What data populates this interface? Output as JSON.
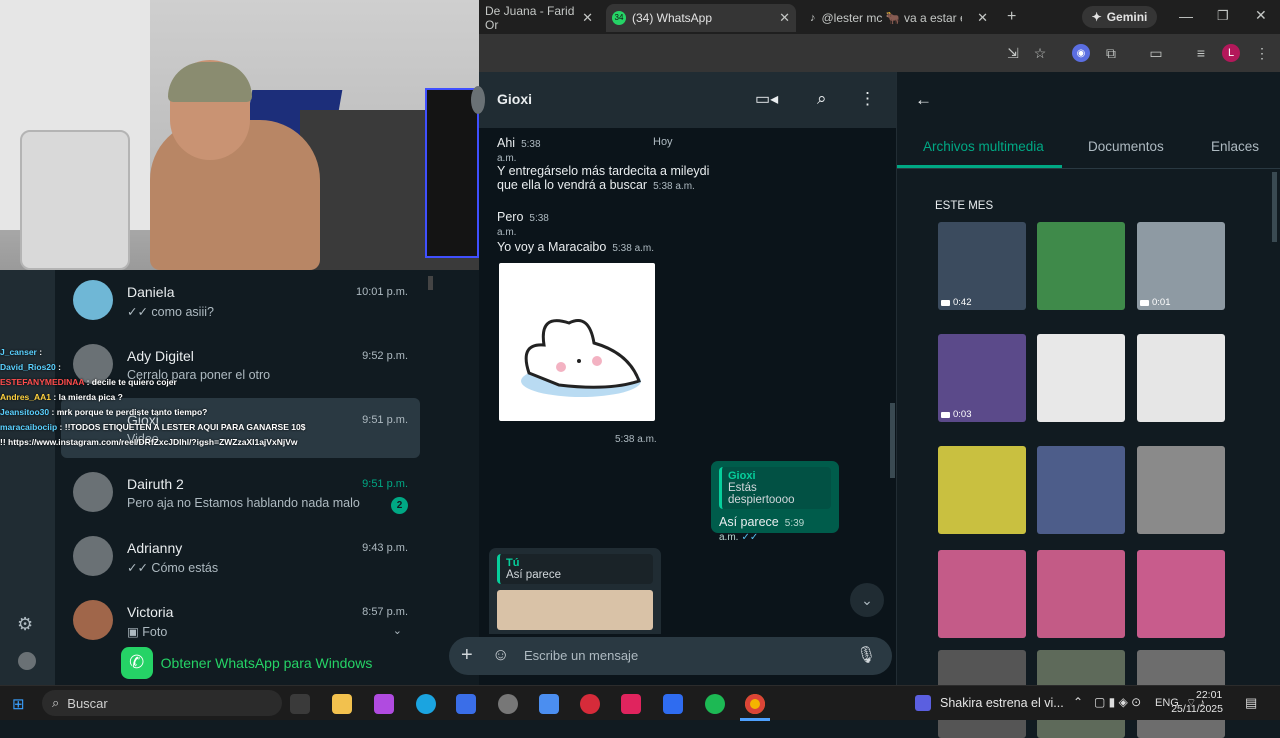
{
  "browser": {
    "tabs": [
      {
        "label": "De Juana - Farid Or"
      },
      {
        "label": "(34) WhatsApp",
        "favicon_text": "34"
      },
      {
        "label": "@lester mc 🐂 va a estar en la"
      }
    ],
    "gemini_label": "Gemini",
    "profile_letter": "L"
  },
  "stream_chat": [
    {
      "user": "J_canser",
      "text": "",
      "color": "#5ad1ff"
    },
    {
      "user": "David_Rios20",
      "text": "",
      "color": "#5ad1ff"
    },
    {
      "user": "ESTEFANYMEDINAA",
      "text": "decile te quiero cojer",
      "color": "#ff4d4d"
    },
    {
      "user": "Andres_AA1",
      "text": "la mierda pica ?",
      "color": "#ffd23f"
    },
    {
      "user": "Jeansitoo30",
      "text": "mrk porque te perdiste tanto tiempo?",
      "color": "#5ad1ff"
    },
    {
      "user": "maracaibociip",
      "text": "!!TODOS ETIQUETEN A LESTER AQUI PARA GANARSE 10$",
      "color": "#5ad1ff"
    },
    {
      "user": "",
      "text": "!! https://www.instagram.com/reel/DRfZxcJDlhl/?igsh=ZWZzaXI1ajVxNjVw",
      "color": "#ffffff"
    }
  ],
  "chat_list": [
    {
      "name": "Daniela",
      "preview": "✓✓ como asiii?",
      "time": "10:01 p.m."
    },
    {
      "name": "Ady Digitel",
      "preview": "Cerralo para poner el otro",
      "time": "9:52 p.m."
    },
    {
      "name": "Gioxi",
      "preview": "Video",
      "time": "9:51 p.m."
    },
    {
      "name": "Dairuth 2",
      "preview": "Pero aja no Estamos hablando nada malo",
      "time": "9:51 p.m.",
      "unread": "2"
    },
    {
      "name": "Adrianny",
      "preview": "✓✓ Cómo estás",
      "time": "9:43 p.m."
    },
    {
      "name": "Victoria",
      "preview": "Foto",
      "time": "8:57 p.m."
    }
  ],
  "get_whatsapp": "Obtener WhatsApp para Windows",
  "conversation": {
    "contact": "Gioxi",
    "day_label": "Hoy",
    "messages": [
      {
        "text": "Ahi",
        "time": "5:38 a.m."
      },
      {
        "text": "Y entregárselo más tardecita a mileydi que ella lo vendrá a buscar",
        "time": "5:38 a.m."
      },
      {
        "text": "Pero",
        "time": "5:38 a.m."
      },
      {
        "text": "Yo voy a Maracaibo",
        "time": "5:38 a.m."
      },
      {
        "sticker_time": "5:38 a.m."
      }
    ],
    "reply_out": {
      "quoted_name": "Gioxi",
      "quoted_text": "Estás despiertoooo",
      "text": "Así parece",
      "time": "5:39 a.m."
    },
    "reply_in": {
      "quoted_name": "Tú",
      "quoted_text": "Así parece"
    },
    "composer_placeholder": "Escribe un mensaje"
  },
  "media_panel": {
    "tabs": [
      "Archivos multimedia",
      "Documentos",
      "Enlaces"
    ],
    "section_label": "ESTE MES",
    "thumbs": [
      {
        "kind": "video",
        "duration": "0:42",
        "color": "#3b4b5e"
      },
      {
        "kind": "image",
        "duration": "",
        "color": "#3f8a4a"
      },
      {
        "kind": "video",
        "duration": "0:01",
        "color": "#8e9aa3"
      },
      {
        "kind": "video",
        "duration": "0:03",
        "color": "#5b4a8a"
      },
      {
        "kind": "image",
        "duration": "",
        "color": "#e8e8e8"
      },
      {
        "kind": "image",
        "duration": "",
        "color": "#e6e6e6"
      },
      {
        "kind": "image",
        "duration": "",
        "color": "#c9c040"
      },
      {
        "kind": "image",
        "duration": "",
        "color": "#4d5d8a"
      },
      {
        "kind": "image",
        "duration": "",
        "color": "#8a8a8a"
      },
      {
        "kind": "image",
        "duration": "",
        "color": "#c45b88"
      },
      {
        "kind": "image",
        "duration": "",
        "color": "#c35b86"
      },
      {
        "kind": "image",
        "duration": "",
        "color": "#c85c8c"
      },
      {
        "kind": "image",
        "duration": "",
        "color": "#555555"
      },
      {
        "kind": "image",
        "duration": "",
        "color": "#5e6a5a"
      },
      {
        "kind": "image",
        "duration": "",
        "color": "#6d6d6d"
      }
    ]
  },
  "taskbar": {
    "search_label": "Buscar",
    "news_text": "Shakira estrena el vi...",
    "lang": "ENG",
    "time": "22:01",
    "date": "25/11/2025"
  },
  "colors": {
    "accent": "#00a884",
    "bubble_out": "#005c4b",
    "bubble_in": "#202c33"
  }
}
